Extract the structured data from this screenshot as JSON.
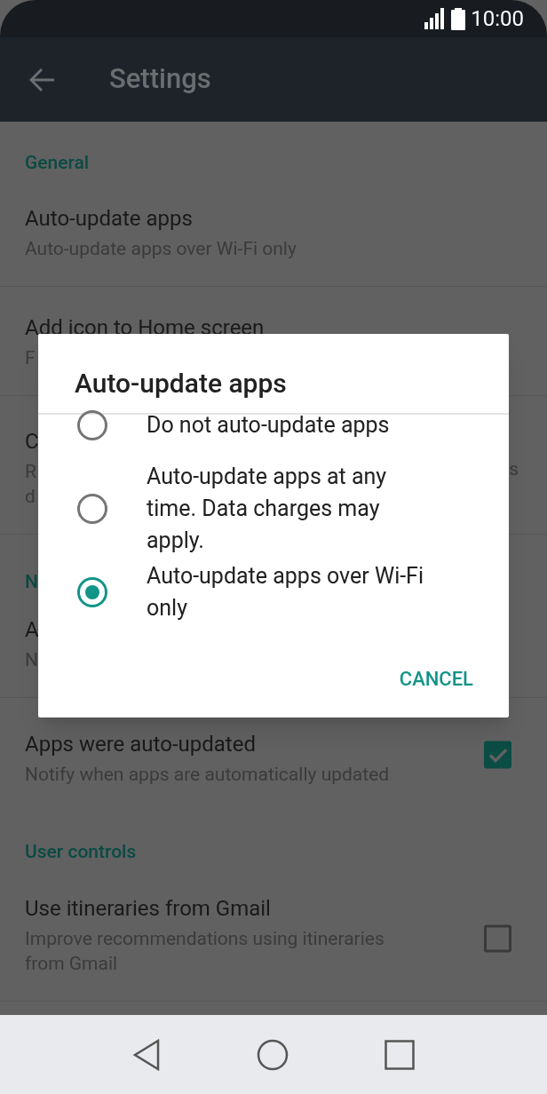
{
  "status_bar": {
    "time": "10:00"
  },
  "app_bar": {
    "title": "Settings"
  },
  "list": [
    {
      "kind": "header",
      "text": "General"
    },
    {
      "kind": "item",
      "title": "Auto-update apps",
      "subtitle_lines": [
        "Auto-update apps over Wi-Fi only"
      ]
    },
    {
      "kind": "item",
      "title": "Add icon to Home screen",
      "subtitle_lines": [
        "F"
      ]
    },
    {
      "kind": "item",
      "title": "C",
      "subtitle_lines": [
        "R",
        "d"
      ],
      "trailing_fragment": "s"
    },
    {
      "kind": "header",
      "text": "N"
    },
    {
      "kind": "item",
      "title": "A",
      "subtitle_lines": [
        "N"
      ]
    },
    {
      "kind": "item",
      "title": "Apps were auto-updated",
      "subtitle_lines": [
        "Notify when apps are automatically updated"
      ],
      "checkbox": {
        "checked": true
      }
    },
    {
      "kind": "header",
      "text": "User controls"
    },
    {
      "kind": "item",
      "title": "Use itineraries from Gmail",
      "subtitle_lines": [
        "Improve recommendations using itineraries",
        "from Gmail"
      ],
      "checkbox": {
        "checked": false
      }
    }
  ],
  "dialog": {
    "title": "Auto-update apps",
    "options": [
      {
        "label": "Do not auto-update apps",
        "selected": false
      },
      {
        "label": "Auto-update apps at any time. Data charges may apply.",
        "selected": false
      },
      {
        "label": "Auto-update apps over Wi-Fi only",
        "selected": true
      }
    ],
    "button": "CANCEL"
  }
}
